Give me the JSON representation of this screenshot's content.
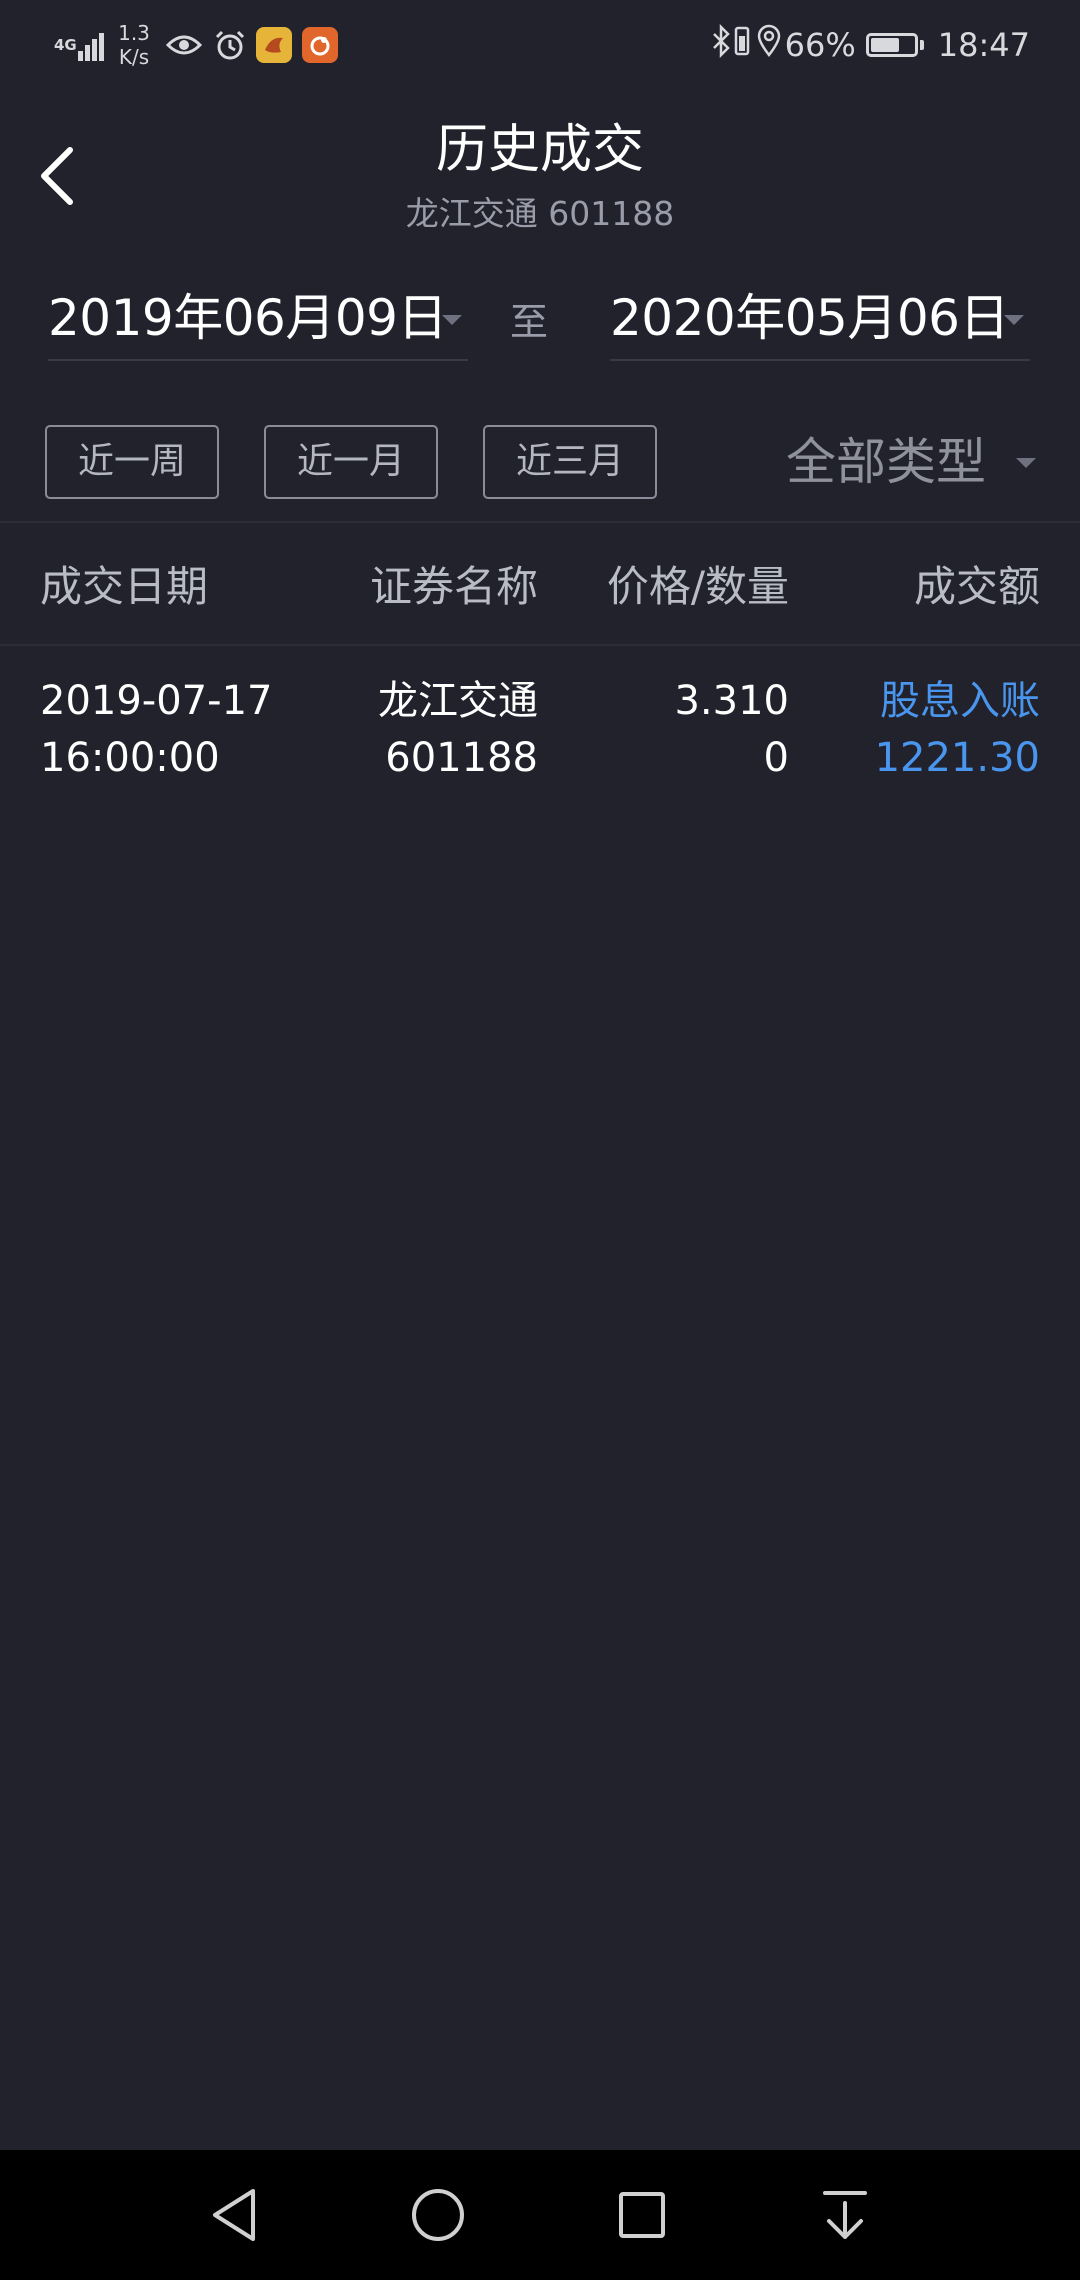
{
  "status_bar": {
    "network_type": "4G",
    "net_speed_value": "1.3",
    "net_speed_unit": "K/s",
    "battery_percent": "66%",
    "battery_level": 0.66,
    "time": "18:47"
  },
  "header": {
    "title": "历史成交",
    "subtitle": "龙江交通 601188"
  },
  "date_range": {
    "start": "2019年06月09日",
    "separator": "至",
    "end": "2020年05月06日"
  },
  "filters": {
    "week": "近一周",
    "month": "近一月",
    "three_months": "近三月",
    "type_select": "全部类型"
  },
  "table": {
    "headers": {
      "date": "成交日期",
      "name": "证券名称",
      "price_qty": "价格/数量",
      "amount": "成交额"
    },
    "rows": [
      {
        "date": "2019-07-17",
        "time": "16:00:00",
        "name": "龙江交通",
        "code": "601188",
        "price": "3.310",
        "quantity": "0",
        "type": "股息入账",
        "amount": "1221.30"
      }
    ]
  },
  "colors": {
    "background": "#21222c",
    "accent_blue": "#4a96ef",
    "nav_bar": "#000000"
  },
  "icons": {
    "back": "chevron-left-icon",
    "nav_back": "triangle-back-icon",
    "nav_home": "circle-home-icon",
    "nav_recent": "square-recent-icon",
    "nav_down": "download-arrow-icon"
  }
}
